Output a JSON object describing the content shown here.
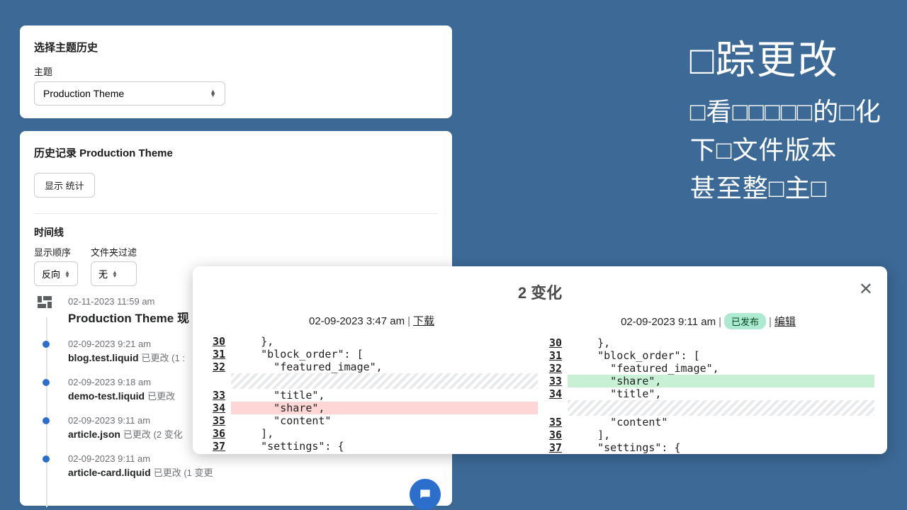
{
  "panel1": {
    "title": "选择主题历史",
    "theme_label": "主题",
    "theme_value": "Production Theme"
  },
  "panel2": {
    "title": "历史记录 Production Theme",
    "show_stats": "显示 统计"
  },
  "tl": {
    "label": "时间线",
    "order_label": "显示顺序",
    "order_value": "反向",
    "filter_label": "文件夹过滤",
    "filter_value": "无",
    "items": [
      {
        "ts": "02-11-2023 11:59 am",
        "title": "Production Theme 现"
      },
      {
        "ts": "02-09-2023 9:21 am",
        "file": "blog.test.liquid",
        "meta": "已更改 (1 :"
      },
      {
        "ts": "02-09-2023 9:18 am",
        "file": "demo-test.liquid",
        "meta": "已更改"
      },
      {
        "ts": "02-09-2023 9:11 am",
        "file": "article.json",
        "meta": "已更改 (2 变化"
      },
      {
        "ts": "02-09-2023 9:11 am",
        "file": "article-card.liquid",
        "meta": "已更改 (1 变更"
      }
    ]
  },
  "promo": {
    "h1": "□踪更改",
    "l1": "□看□□□□□的□化",
    "l2": "下□文件版本",
    "l3": "甚至整□主□"
  },
  "modal": {
    "title": "2 变化",
    "left": {
      "ts": "02-09-2023 3:47 am",
      "download": "下载"
    },
    "right": {
      "ts": "02-09-2023 9:11 am",
      "pub": "已发布",
      "edit": "编辑"
    },
    "left_lines": [
      {
        "n": "30",
        "t": "    },"
      },
      {
        "n": "31",
        "t": "    \"block_order\": ["
      },
      {
        "n": "32",
        "t": "      \"featured_image\","
      },
      {
        "n": "",
        "t": "",
        "cls": "hatch"
      },
      {
        "n": "33",
        "t": "      \"title\","
      },
      {
        "n": "34",
        "t": "      \"share\",",
        "cls": "del"
      },
      {
        "n": "35",
        "t": "      \"content\""
      },
      {
        "n": "36",
        "t": "    ],"
      },
      {
        "n": "37",
        "t": "    \"settings\": {"
      }
    ],
    "right_lines": [
      {
        "n": "30",
        "t": "    },"
      },
      {
        "n": "31",
        "t": "    \"block_order\": ["
      },
      {
        "n": "32",
        "t": "      \"featured_image\","
      },
      {
        "n": "33",
        "t": "      \"share\",",
        "cls": "add"
      },
      {
        "n": "34",
        "t": "      \"title\","
      },
      {
        "n": "",
        "t": "",
        "cls": "hatch"
      },
      {
        "n": "35",
        "t": "      \"content\""
      },
      {
        "n": "36",
        "t": "    ],"
      },
      {
        "n": "37",
        "t": "    \"settings\": {"
      }
    ]
  }
}
